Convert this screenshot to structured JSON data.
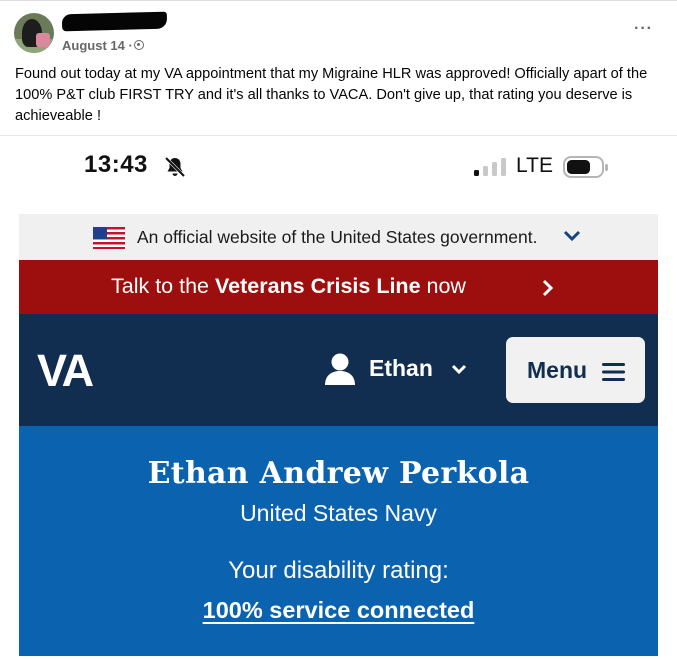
{
  "post": {
    "date": "August 14 ·",
    "text": "Found out today at my VA appointment that my Migraine HLR was approved! Officially apart of the 100% P&T club FIRST TRY and it's all thanks to VACA. Don't give up, that rating you deserve is achieveable !",
    "privacy_icon": "globe-icon",
    "more_icon": "more-options-icon"
  },
  "phone_status": {
    "time": "13:43",
    "network": "LTE"
  },
  "va_site": {
    "official_banner": "An official website of the United States government.",
    "crisis_prefix": "Talk to the ",
    "crisis_bold": "Veterans Crisis Line",
    "crisis_suffix": " now",
    "logo": "VA",
    "user_name": "Ethan",
    "menu_label": "Menu",
    "profile_name": "Ethan Andrew Perkola",
    "branch": "United States Navy",
    "rating_label": "Your disability rating:",
    "rating_value": "100% service connected"
  },
  "colors": {
    "crisis_red": "#9d0f0f",
    "va_navy": "#112e51",
    "va_blue": "#0b63b0",
    "official_gray": "#f0f0f0"
  }
}
